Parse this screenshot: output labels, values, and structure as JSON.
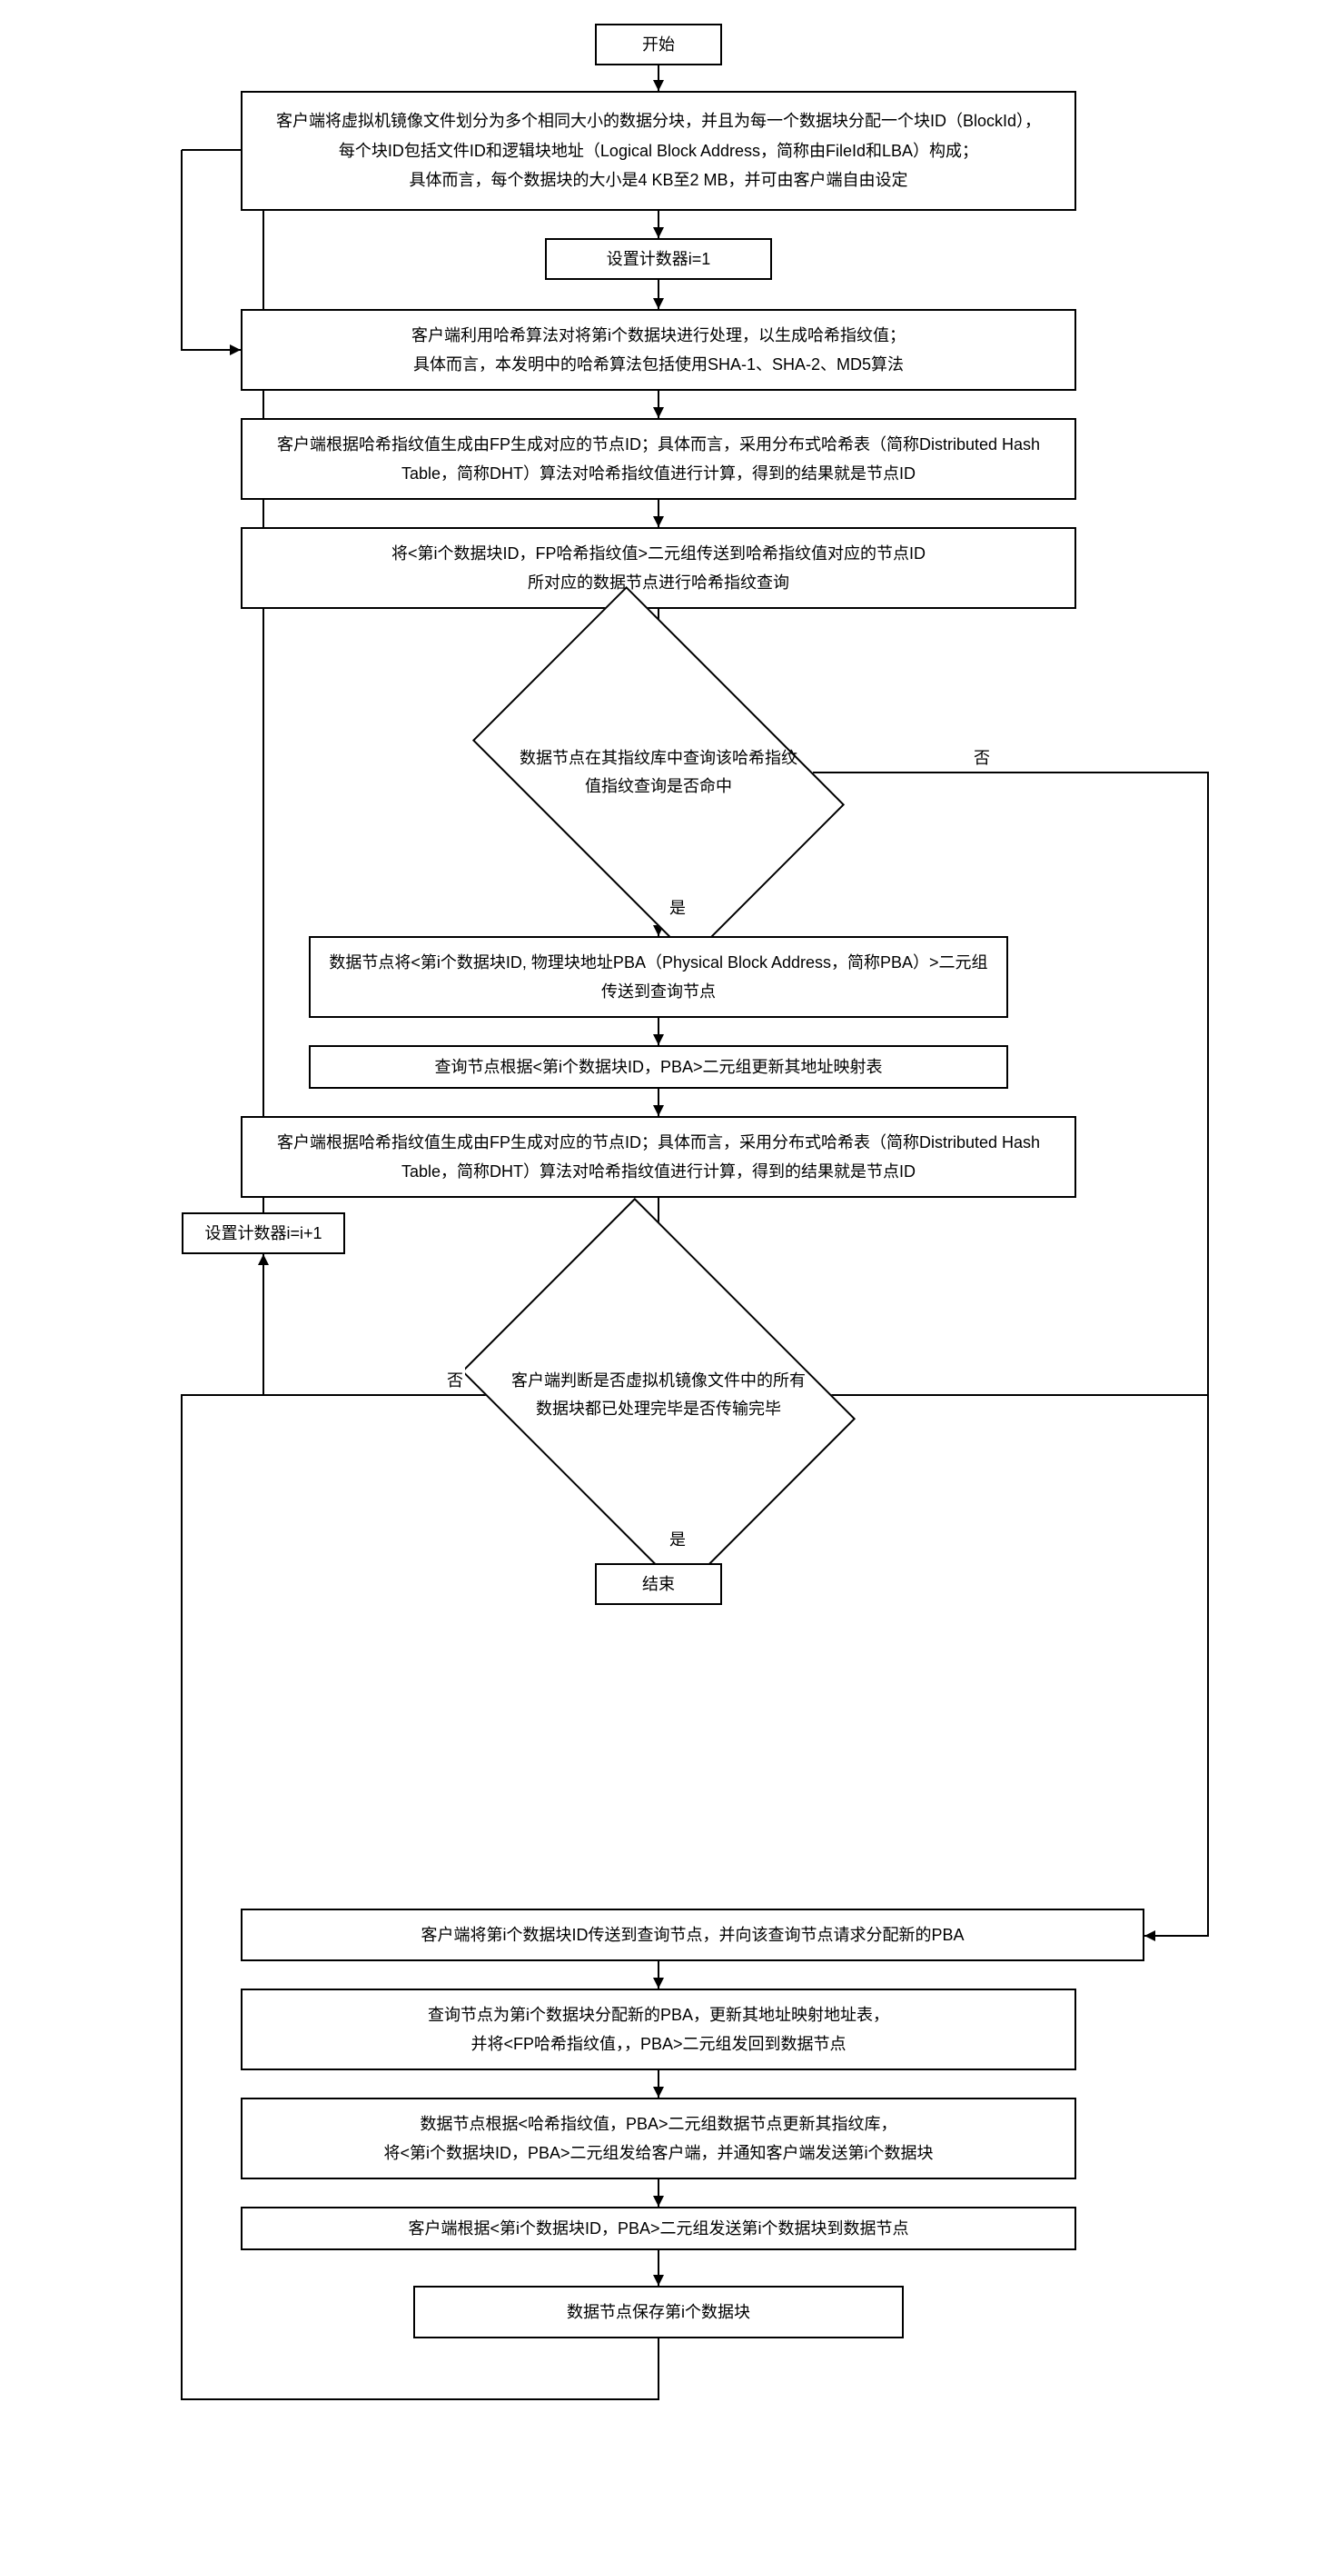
{
  "flowchart": {
    "nodes": {
      "start": "开始",
      "n1": "客户端将虚拟机镜像文件划分为多个相同大小的数据分块，并且为每一个数据块分配一个块ID（BlockId），\n每个块ID包括文件ID和逻辑块地址（Logical Block Address，简称由FileId和LBA）构成；\n具体而言，每个数据块的大小是4 KB至2 MB，并可由客户端自由设定",
      "n2": "设置计数器i=1",
      "n3": "客户端利用哈希算法对将第i个数据块进行处理，以生成哈希指纹值；\n具体而言，本发明中的哈希算法包括使用SHA-1、SHA-2、MD5算法",
      "n4": "客户端根据哈希指纹值生成由FP生成对应的节点ID；具体而言，采用分布式哈希表（简称Distributed Hash Table，简称DHT）算法对哈希指纹值进行计算，得到的结果就是节点ID",
      "n5": "将<第i个数据块ID，FP哈希指纹值>二元组传送到哈希指纹值对应的节点ID\n所对应的数据节点进行哈希指纹查询",
      "d1": "数据节点在其指纹库中查询该哈希指纹值指纹查询是否命中",
      "n6": "数据节点将<第i个数据块ID, 物理块地址PBA（Physical Block Address，简称PBA）>二元组传送到查询节点",
      "n7": "查询节点根据<第i个数据块ID，PBA>二元组更新其地址映射表",
      "n8": "客户端根据哈希指纹值生成由FP生成对应的节点ID；具体而言，采用分布式哈希表（简称Distributed Hash Table，简称DHT）算法对哈希指纹值进行计算，得到的结果就是节点ID",
      "inc": "设置计数器i=i+1",
      "d2": "客户端判断是否虚拟机镜像文件中的所有数据块都已处理完毕是否传输完毕",
      "end": "结束",
      "n9": "客户端将第i个数据块ID传送到查询节点，并向该查询节点请求分配新的PBA",
      "n10": "查询节点为第i个数据块分配新的PBA，更新其地址映射地址表，\n并将<FP哈希指纹值，，PBA>二元组发回到数据节点",
      "n11": "数据节点根据<哈希指纹值，PBA>二元组数据节点更新其指纹库，\n将<第i个数据块ID，PBA>二元组发给客户端，并通知客户端发送第i个数据块",
      "n12": "客户端根据<第i个数据块ID，PBA>二元组发送第i个数据块到数据节点",
      "n13": "数据节点保存第i个数据块"
    },
    "labels": {
      "yes": "是",
      "no": "否"
    }
  }
}
